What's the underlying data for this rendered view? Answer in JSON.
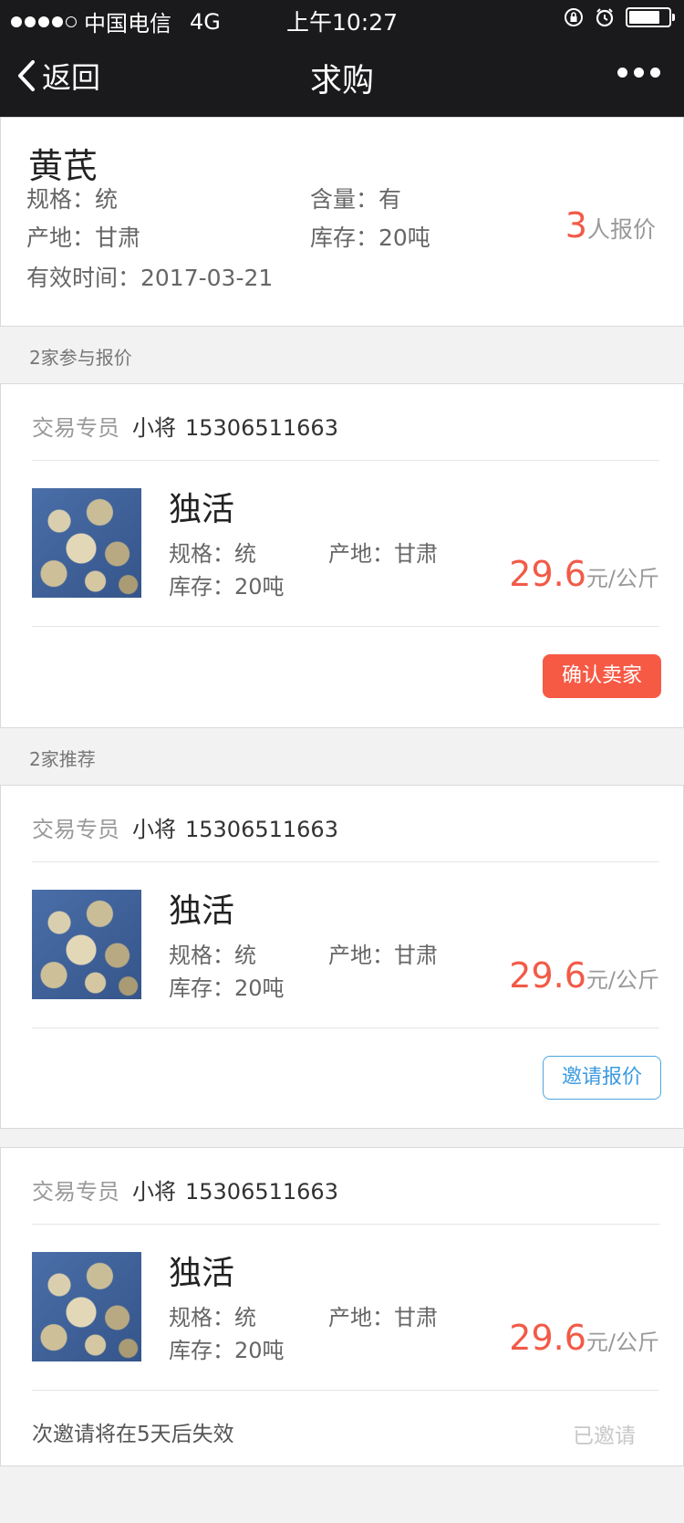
{
  "status_bar": {
    "carrier": "中国电信",
    "network": "4G",
    "time": "上午10:27"
  },
  "nav": {
    "back_label": "返回",
    "title": "求购"
  },
  "summary": {
    "title": "黄芪",
    "spec": "规格：统",
    "content": "含量：有",
    "origin": "产地：甘肃",
    "stock": "库存：20吨",
    "valid": "有效时间：2017-03-21",
    "quote_count": "3",
    "quote_suffix": "人报价"
  },
  "sections": {
    "quoted": "2家参与报价",
    "recommended": "2家推荐"
  },
  "offers": [
    {
      "agent_label": "交易专员",
      "agent_name": "小将",
      "agent_phone": "15306511663",
      "name": "独活",
      "spec": "规格：统",
      "origin": "产地：甘肃",
      "stock": "库存：20吨",
      "price": "29.6",
      "unit": "元/公斤",
      "action": "确认卖家"
    },
    {
      "agent_label": "交易专员",
      "agent_name": "小将",
      "agent_phone": "15306511663",
      "name": "独活",
      "spec": "规格：统",
      "origin": "产地：甘肃",
      "stock": "库存：20吨",
      "price": "29.6",
      "unit": "元/公斤",
      "action": "邀请报价"
    },
    {
      "agent_label": "交易专员",
      "agent_name": "小将",
      "agent_phone": "15306511663",
      "name": "独活",
      "spec": "规格：统",
      "origin": "产地：甘肃",
      "stock": "库存：20吨",
      "price": "29.6",
      "unit": "元/公斤",
      "note": "次邀请将在5天后失效",
      "action": "已邀请"
    }
  ],
  "colors": {
    "accent_red": "#f65a45",
    "accent_blue": "#3c9be0",
    "nav_bg": "#1a1a1c"
  }
}
